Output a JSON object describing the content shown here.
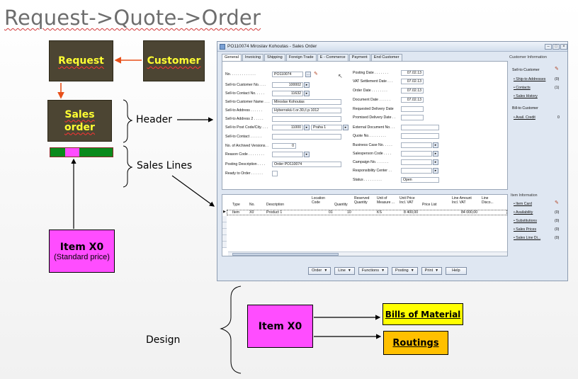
{
  "slide": {
    "title": "Request->Quote->Order"
  },
  "diagram": {
    "request": "Request",
    "customer": "Customer",
    "sales_order_l1": "Sales",
    "sales_order_l2": "order",
    "item_top_l1": "Item X0",
    "item_top_l2": "(Standard price)",
    "label_header": "Header",
    "label_sales_lines": "Sales Lines",
    "label_design": "Design",
    "item_bottom": "Item X0",
    "bills_of_material": "Bills of Material",
    "routings": "Routings"
  },
  "window": {
    "title": "PO110074 Miroslav Kohoutas - Sales Order",
    "tabs": [
      "General",
      "Invoicing",
      "Shipping",
      "Foreign Trade",
      "E - Commerce",
      "Payment",
      "End Customer"
    ],
    "fields_left": [
      {
        "label": "No. . . . . . . . . . . . .",
        "value": "PO110074"
      },
      {
        "label": "Sell-to Customer No. . . .",
        "value": "100002"
      },
      {
        "label": "Sell-to Contact No. . . . .",
        "value": "11632"
      },
      {
        "label": "Sell-to Customer Name . . .",
        "value": "Miroslav Kohoutas"
      },
      {
        "label": "Sell-to Address . . . . . .",
        "value": "Hybernská č.or.30,č.p.1012"
      },
      {
        "label": "Sell-to Address 2 . . . . .",
        "value": ""
      },
      {
        "label": "Sell-to Post Code/City. . . .",
        "value": "11000",
        "value2": "Praha 1"
      },
      {
        "label": "Sell-to Contact . . . . . .",
        "value": ""
      },
      {
        "label": "No. of Archived Versions. .",
        "value": "0"
      },
      {
        "label": "Reason Code . . . . . . . .",
        "value": ""
      },
      {
        "label": "Posting Description . . . .",
        "value": "Order PO110074"
      },
      {
        "label": "Ready to Order . . . . . .",
        "value": ""
      }
    ],
    "fields_right": [
      {
        "label": "Posting Date . . . . . . .",
        "value": "07.02.13"
      },
      {
        "label": "VAT Settlement Date . . .",
        "value": "07.02.13"
      },
      {
        "label": "Order Date . . . . . . . .",
        "value": "07.02.13"
      },
      {
        "label": "Document Date . . . . . .",
        "value": "07.02.13"
      },
      {
        "label": "Requested Delivery Date",
        "value": ""
      },
      {
        "label": "Promised Delivery Date . .",
        "value": ""
      },
      {
        "label": "External Document No. . .",
        "value": ""
      },
      {
        "label": "Quote No. . . . . . . . .",
        "value": ""
      },
      {
        "label": "Business Case No. . . . .",
        "value": ""
      },
      {
        "label": "Salesperson Code . . . .",
        "value": ""
      },
      {
        "label": "Campaign No. . . . . . .",
        "value": ""
      },
      {
        "label": "Responsibility Center . .",
        "value": ""
      },
      {
        "label": "Status . . . . . . . . .",
        "value": "Open"
      }
    ],
    "factbox_customer": {
      "title": "Customer Information",
      "items": [
        {
          "label": "Sell-to Customer",
          "value": ""
        },
        {
          "label": "• Ship-to Addresses",
          "value": "(0)"
        },
        {
          "label": "• Contacts",
          "value": "(1)"
        },
        {
          "label": "• Sales History",
          "value": ""
        },
        {
          "label": "Bill-to Customer",
          "value": ""
        },
        {
          "label": "• Avail. Credit",
          "value": "0"
        }
      ]
    },
    "factbox_item": {
      "title": "Item Information",
      "items": [
        {
          "label": "• Item Card",
          "value": ""
        },
        {
          "label": "• Availability",
          "value": "(0)"
        },
        {
          "label": "• Substitutions",
          "value": "(0)"
        },
        {
          "label": "• Sales Prices",
          "value": "(0)"
        },
        {
          "label": "• Sales Line Di...",
          "value": "(0)"
        }
      ]
    },
    "lines_headers": [
      "Type",
      "No.",
      "Description",
      "Location Code",
      "Quantity",
      "Reserved Quantity",
      "Unit of Measure ...",
      "Unit Price Incl. VAT",
      "Price List",
      "Line Amount Incl. VAT",
      "Line Disco..."
    ],
    "line_row": {
      "type": "Item",
      "no": "X0",
      "description": "Product 1",
      "location": "01",
      "quantity": "10",
      "uom": "KS",
      "unit_price": "8 400,00",
      "line_amount": "84 000,00"
    },
    "buttons": [
      "Order",
      "Line",
      "Functions",
      "Posting",
      "Print",
      "Help"
    ]
  }
}
